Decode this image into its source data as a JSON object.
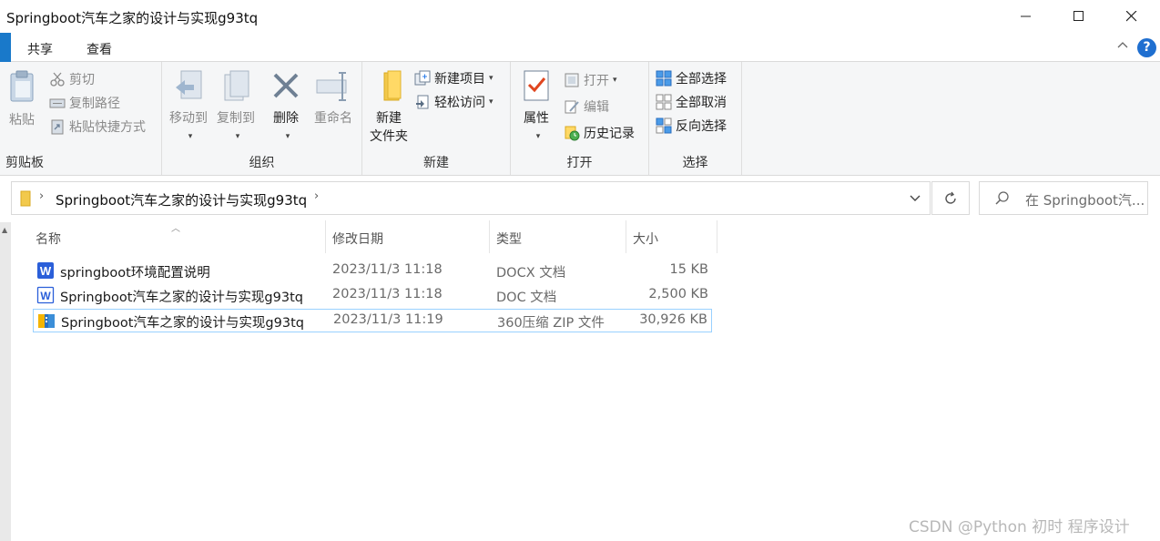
{
  "window": {
    "title": "Springboot汽车之家的设计与实现g93tq"
  },
  "ribbon_tabs": {
    "share": "共享",
    "view": "查看"
  },
  "ribbon": {
    "clipboard": {
      "label": "剪贴板",
      "paste": "粘贴",
      "cut": "剪切",
      "copy_path": "复制路径",
      "paste_shortcut": "粘贴快捷方式"
    },
    "organize": {
      "label": "组织",
      "move_to": "移动到",
      "copy_to": "复制到",
      "delete": "删除",
      "rename": "重命名"
    },
    "new": {
      "label": "新建",
      "new_folder_line1": "新建",
      "new_folder_line2": "文件夹",
      "new_item": "新建项目",
      "easy_access": "轻松访问"
    },
    "open": {
      "label": "打开",
      "properties": "属性",
      "open": "打开",
      "edit": "编辑",
      "history": "历史记录"
    },
    "select": {
      "label": "选择",
      "select_all": "全部选择",
      "select_none": "全部取消",
      "invert": "反向选择"
    }
  },
  "address": {
    "path": "Springboot汽车之家的设计与实现g93tq"
  },
  "search": {
    "placeholder": "在 Springboot汽..."
  },
  "columns": {
    "name": "名称",
    "date": "修改日期",
    "type": "类型",
    "size": "大小"
  },
  "files": [
    {
      "name": "springboot环境配置说明",
      "date": "2023/11/3 11:18",
      "type": "DOCX 文档",
      "size": "15 KB",
      "icon": "word-docx-icon"
    },
    {
      "name": "Springboot汽车之家的设计与实现g93tq",
      "date": "2023/11/3 11:18",
      "type": "DOC 文档",
      "size": "2,500 KB",
      "icon": "word-doc-icon"
    },
    {
      "name": "Springboot汽车之家的设计与实现g93tq",
      "date": "2023/11/3 11:19",
      "type": "360压缩 ZIP 文件",
      "size": "30,926 KB",
      "icon": "zip-archive-icon"
    }
  ],
  "watermark": "CSDN @Python 初时 程序设计",
  "colors": {
    "accent": "#1979ca",
    "selection_border": "#99d1ff",
    "ribbon_bg": "#f5f6f7"
  }
}
